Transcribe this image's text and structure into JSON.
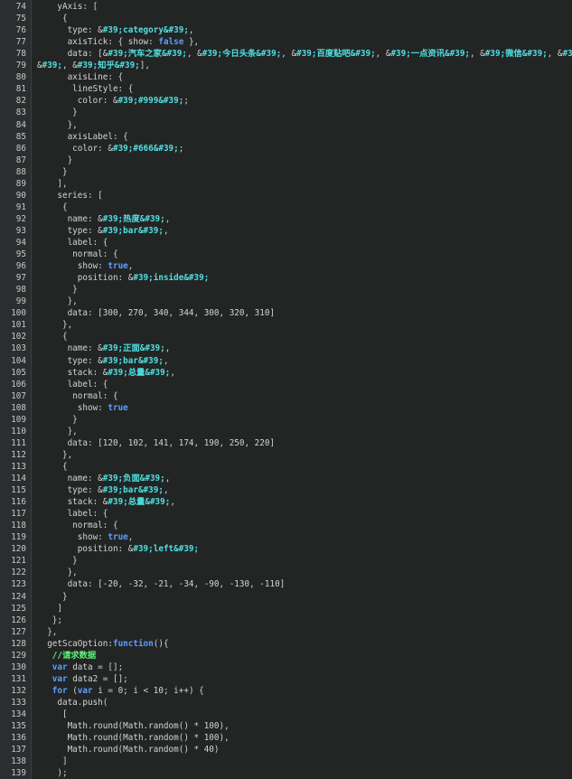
{
  "colors": {
    "background": "#232525",
    "gutter": "#2b2d2e",
    "line_number": "#c9c9c9",
    "plain_text": "#d4d4d4",
    "keyword": "#5aa0ff",
    "string": "#4fe0e0",
    "comment": "#5ef07a"
  },
  "editor": {
    "lines": [
      {
        "n": "74",
        "tokens": [
          {
            "t": "    yAxis: [",
            "k": "plain"
          }
        ]
      },
      {
        "n": "75",
        "tokens": [
          {
            "t": "     {",
            "k": "plain"
          }
        ]
      },
      {
        "n": "76",
        "tokens": [
          {
            "t": "      type: &",
            "k": "plain"
          },
          {
            "t": "#39;category&#39;",
            "k": "str"
          },
          {
            "t": ",",
            "k": "plain"
          }
        ]
      },
      {
        "n": "77",
        "tokens": [
          {
            "t": "      axisTick: { show: ",
            "k": "plain"
          },
          {
            "t": "false",
            "k": "kw"
          },
          {
            "t": " },",
            "k": "plain"
          }
        ]
      },
      {
        "n": "78",
        "tokens": [
          {
            "t": "      data: [&",
            "k": "plain"
          },
          {
            "t": "#39;汽车之家&#39;",
            "k": "str"
          },
          {
            "t": ", &",
            "k": "plain"
          },
          {
            "t": "#39;今日头条&#39;",
            "k": "str"
          },
          {
            "t": ", &",
            "k": "plain"
          },
          {
            "t": "#39;百度贴吧&#39;",
            "k": "str"
          },
          {
            "t": ", &",
            "k": "plain"
          },
          {
            "t": "#39;一点资讯&#39;",
            "k": "str"
          },
          {
            "t": ", &",
            "k": "plain"
          },
          {
            "t": "#39;微信&#39;",
            "k": "str"
          },
          {
            "t": ", &",
            "k": "plain"
          },
          {
            "t": "#39;微博",
            "k": "str"
          }
        ]
      },
      {
        "n": "79",
        "tokens": [
          {
            "t": "&",
            "k": "plain"
          },
          {
            "t": "#39;",
            "k": "str"
          },
          {
            "t": ", &",
            "k": "plain"
          },
          {
            "t": "#39;知乎&#39;",
            "k": "str"
          },
          {
            "t": "],",
            "k": "plain"
          }
        ]
      },
      {
        "n": "80",
        "tokens": [
          {
            "t": "      axisLine: {",
            "k": "plain"
          }
        ]
      },
      {
        "n": "81",
        "tokens": [
          {
            "t": "       lineStyle: {",
            "k": "plain"
          }
        ]
      },
      {
        "n": "82",
        "tokens": [
          {
            "t": "        color: &",
            "k": "plain"
          },
          {
            "t": "#39;#999&#39;",
            "k": "str"
          },
          {
            "t": ";",
            "k": "plain"
          }
        ]
      },
      {
        "n": "83",
        "tokens": [
          {
            "t": "       }",
            "k": "plain"
          }
        ]
      },
      {
        "n": "84",
        "tokens": [
          {
            "t": "      },",
            "k": "plain"
          }
        ]
      },
      {
        "n": "85",
        "tokens": [
          {
            "t": "      axisLabel: {",
            "k": "plain"
          }
        ]
      },
      {
        "n": "86",
        "tokens": [
          {
            "t": "       color: &",
            "k": "plain"
          },
          {
            "t": "#39;#666&#39;",
            "k": "str"
          },
          {
            "t": ";",
            "k": "plain"
          }
        ]
      },
      {
        "n": "87",
        "tokens": [
          {
            "t": "      }",
            "k": "plain"
          }
        ]
      },
      {
        "n": "88",
        "tokens": [
          {
            "t": "     }",
            "k": "plain"
          }
        ]
      },
      {
        "n": "89",
        "tokens": [
          {
            "t": "    ],",
            "k": "plain"
          }
        ]
      },
      {
        "n": "90",
        "tokens": [
          {
            "t": "    series: [",
            "k": "plain"
          }
        ]
      },
      {
        "n": "91",
        "tokens": [
          {
            "t": "     {",
            "k": "plain"
          }
        ]
      },
      {
        "n": "92",
        "tokens": [
          {
            "t": "      name: &",
            "k": "plain"
          },
          {
            "t": "#39;热度&#39;",
            "k": "str"
          },
          {
            "t": ",",
            "k": "plain"
          }
        ]
      },
      {
        "n": "93",
        "tokens": [
          {
            "t": "      type: &",
            "k": "plain"
          },
          {
            "t": "#39;bar&#39;",
            "k": "str"
          },
          {
            "t": ",",
            "k": "plain"
          }
        ]
      },
      {
        "n": "94",
        "tokens": [
          {
            "t": "      label: {",
            "k": "plain"
          }
        ]
      },
      {
        "n": "95",
        "tokens": [
          {
            "t": "       normal: {",
            "k": "plain"
          }
        ]
      },
      {
        "n": "96",
        "tokens": [
          {
            "t": "        show: ",
            "k": "plain"
          },
          {
            "t": "true",
            "k": "kw"
          },
          {
            "t": ",",
            "k": "plain"
          }
        ]
      },
      {
        "n": "97",
        "tokens": [
          {
            "t": "        position: &",
            "k": "plain"
          },
          {
            "t": "#39;inside&#39;",
            "k": "str"
          }
        ]
      },
      {
        "n": "98",
        "tokens": [
          {
            "t": "       }",
            "k": "plain"
          }
        ]
      },
      {
        "n": "99",
        "tokens": [
          {
            "t": "      },",
            "k": "plain"
          }
        ]
      },
      {
        "n": "100",
        "tokens": [
          {
            "t": "      data: [300, 270, 340, 344, 300, 320, 310]",
            "k": "plain"
          }
        ]
      },
      {
        "n": "101",
        "tokens": [
          {
            "t": "     },",
            "k": "plain"
          }
        ]
      },
      {
        "n": "102",
        "tokens": [
          {
            "t": "     {",
            "k": "plain"
          }
        ]
      },
      {
        "n": "103",
        "tokens": [
          {
            "t": "      name: &",
            "k": "plain"
          },
          {
            "t": "#39;正面&#39;",
            "k": "str"
          },
          {
            "t": ",",
            "k": "plain"
          }
        ]
      },
      {
        "n": "104",
        "tokens": [
          {
            "t": "      type: &",
            "k": "plain"
          },
          {
            "t": "#39;bar&#39;",
            "k": "str"
          },
          {
            "t": ",",
            "k": "plain"
          }
        ]
      },
      {
        "n": "105",
        "tokens": [
          {
            "t": "      stack: &",
            "k": "plain"
          },
          {
            "t": "#39;总量&#39;",
            "k": "str"
          },
          {
            "t": ",",
            "k": "plain"
          }
        ]
      },
      {
        "n": "106",
        "tokens": [
          {
            "t": "      label: {",
            "k": "plain"
          }
        ]
      },
      {
        "n": "107",
        "tokens": [
          {
            "t": "       normal: {",
            "k": "plain"
          }
        ]
      },
      {
        "n": "108",
        "tokens": [
          {
            "t": "        show: ",
            "k": "plain"
          },
          {
            "t": "true",
            "k": "kw"
          }
        ]
      },
      {
        "n": "109",
        "tokens": [
          {
            "t": "       }",
            "k": "plain"
          }
        ]
      },
      {
        "n": "110",
        "tokens": [
          {
            "t": "      },",
            "k": "plain"
          }
        ]
      },
      {
        "n": "111",
        "tokens": [
          {
            "t": "      data: [120, 102, 141, 174, 190, 250, 220]",
            "k": "plain"
          }
        ]
      },
      {
        "n": "112",
        "tokens": [
          {
            "t": "     },",
            "k": "plain"
          }
        ]
      },
      {
        "n": "113",
        "tokens": [
          {
            "t": "     {",
            "k": "plain"
          }
        ]
      },
      {
        "n": "114",
        "tokens": [
          {
            "t": "      name: &",
            "k": "plain"
          },
          {
            "t": "#39;负面&#39;",
            "k": "str"
          },
          {
            "t": ",",
            "k": "plain"
          }
        ]
      },
      {
        "n": "115",
        "tokens": [
          {
            "t": "      type: &",
            "k": "plain"
          },
          {
            "t": "#39;bar&#39;",
            "k": "str"
          },
          {
            "t": ",",
            "k": "plain"
          }
        ]
      },
      {
        "n": "116",
        "tokens": [
          {
            "t": "      stack: &",
            "k": "plain"
          },
          {
            "t": "#39;总量&#39;",
            "k": "str"
          },
          {
            "t": ",",
            "k": "plain"
          }
        ]
      },
      {
        "n": "117",
        "tokens": [
          {
            "t": "      label: {",
            "k": "plain"
          }
        ]
      },
      {
        "n": "118",
        "tokens": [
          {
            "t": "       normal: {",
            "k": "plain"
          }
        ]
      },
      {
        "n": "119",
        "tokens": [
          {
            "t": "        show: ",
            "k": "plain"
          },
          {
            "t": "true",
            "k": "kw"
          },
          {
            "t": ",",
            "k": "plain"
          }
        ]
      },
      {
        "n": "120",
        "tokens": [
          {
            "t": "        position: &",
            "k": "plain"
          },
          {
            "t": "#39;left&#39;",
            "k": "str"
          }
        ]
      },
      {
        "n": "121",
        "tokens": [
          {
            "t": "       }",
            "k": "plain"
          }
        ]
      },
      {
        "n": "122",
        "tokens": [
          {
            "t": "      },",
            "k": "plain"
          }
        ]
      },
      {
        "n": "123",
        "tokens": [
          {
            "t": "      data: [-20, -32, -21, -34, -90, -130, -110]",
            "k": "plain"
          }
        ]
      },
      {
        "n": "124",
        "tokens": [
          {
            "t": "     }",
            "k": "plain"
          }
        ]
      },
      {
        "n": "125",
        "tokens": [
          {
            "t": "    ]",
            "k": "plain"
          }
        ]
      },
      {
        "n": "126",
        "tokens": [
          {
            "t": "   };",
            "k": "plain"
          }
        ]
      },
      {
        "n": "127",
        "tokens": [
          {
            "t": "  },",
            "k": "plain"
          }
        ]
      },
      {
        "n": "128",
        "tokens": [
          {
            "t": "  getScaOption:",
            "k": "plain"
          },
          {
            "t": "function",
            "k": "kw"
          },
          {
            "t": "(){",
            "k": "plain"
          }
        ]
      },
      {
        "n": "129",
        "tokens": [
          {
            "t": "   ",
            "k": "plain"
          },
          {
            "t": "//请求数据",
            "k": "cm"
          }
        ]
      },
      {
        "n": "130",
        "tokens": [
          {
            "t": "   ",
            "k": "plain"
          },
          {
            "t": "var",
            "k": "kw"
          },
          {
            "t": " data = [];",
            "k": "plain"
          }
        ]
      },
      {
        "n": "131",
        "tokens": [
          {
            "t": "   ",
            "k": "plain"
          },
          {
            "t": "var",
            "k": "kw"
          },
          {
            "t": " data2 = [];",
            "k": "plain"
          }
        ]
      },
      {
        "n": "132",
        "tokens": [
          {
            "t": "   ",
            "k": "plain"
          },
          {
            "t": "for",
            "k": "kw"
          },
          {
            "t": " (",
            "k": "plain"
          },
          {
            "t": "var",
            "k": "kw"
          },
          {
            "t": " i = 0; i < 10; i++) {",
            "k": "plain"
          }
        ]
      },
      {
        "n": "133",
        "tokens": [
          {
            "t": "    data.push(",
            "k": "plain"
          }
        ]
      },
      {
        "n": "134",
        "tokens": [
          {
            "t": "     [",
            "k": "plain"
          }
        ]
      },
      {
        "n": "135",
        "tokens": [
          {
            "t": "      Math.round(Math.random() * 100),",
            "k": "plain"
          }
        ]
      },
      {
        "n": "136",
        "tokens": [
          {
            "t": "      Math.round(Math.random() * 100),",
            "k": "plain"
          }
        ]
      },
      {
        "n": "137",
        "tokens": [
          {
            "t": "      Math.round(Math.random() * 40)",
            "k": "plain"
          }
        ]
      },
      {
        "n": "138",
        "tokens": [
          {
            "t": "     ]",
            "k": "plain"
          }
        ]
      },
      {
        "n": "139",
        "tokens": [
          {
            "t": "    );",
            "k": "plain"
          }
        ]
      }
    ]
  }
}
